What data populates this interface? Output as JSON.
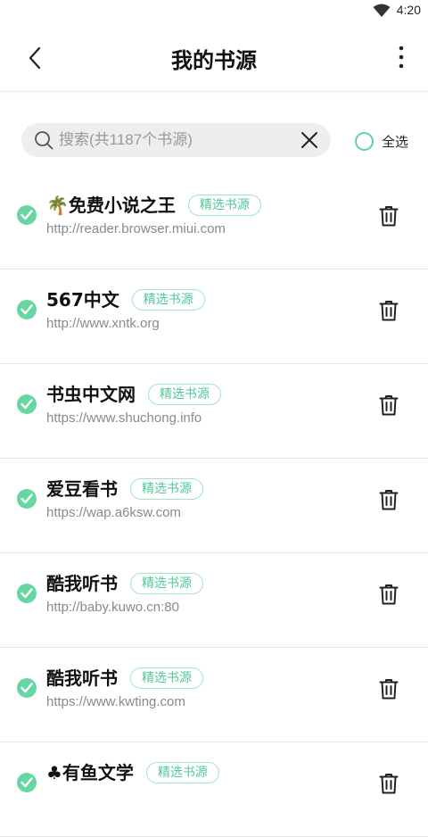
{
  "status_bar": {
    "time": "4:20",
    "icon": "wifi-icon"
  },
  "header": {
    "title": "我的书源",
    "back_icon": "back-arrow-icon",
    "more_icon": "more-vert-icon"
  },
  "search": {
    "placeholder": "搜索(共1187个书源)",
    "value": "",
    "icon": "search-icon",
    "clear_icon": "close-icon"
  },
  "select_all": {
    "label": "全选",
    "checked": false
  },
  "colors": {
    "accent": "#66d6a3",
    "tag_border": "#9fe4c6",
    "tag_text": "#4fc996"
  },
  "sources": [
    {
      "name": "🌴免费小说之王",
      "tag": "精选书源",
      "url": "http://reader.browser.miui.com",
      "checked": true
    },
    {
      "name": "567中文",
      "tag": "精选书源",
      "url": "http://www.xntk.org",
      "checked": true
    },
    {
      "name": "书虫中文网",
      "tag": "精选书源",
      "url": "https://www.shuchong.info",
      "checked": true
    },
    {
      "name": "爱豆看书",
      "tag": "精选书源",
      "url": "https://wap.a6ksw.com",
      "checked": true
    },
    {
      "name": "酷我听书",
      "tag": "精选书源",
      "url": "http://baby.kuwo.cn:80",
      "checked": true
    },
    {
      "name": "酷我听书",
      "tag": "精选书源",
      "url": "https://www.kwting.com",
      "checked": true
    },
    {
      "name": "♣有鱼文学",
      "tag": "精选书源",
      "url": "",
      "checked": true
    }
  ]
}
